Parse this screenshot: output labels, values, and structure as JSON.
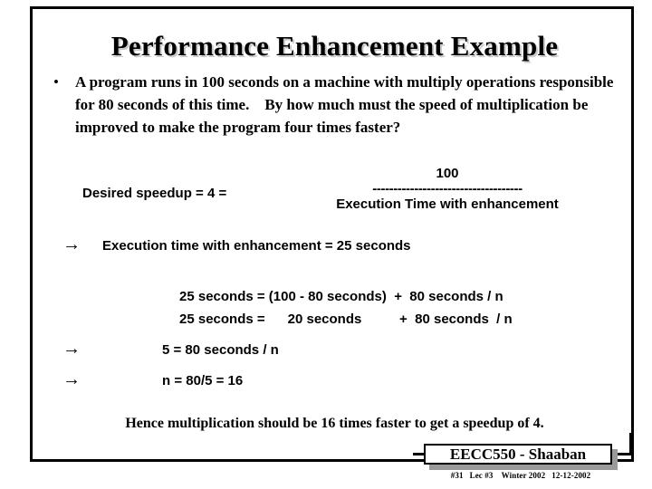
{
  "slide": {
    "title": "Performance Enhancement Example",
    "bullet": {
      "marker": "•",
      "text": "A program runs in 100 seconds on a machine with multiply operations responsible for 80 seconds of this time.    By how much must the speed of multiplication be improved to make the program four times faster?"
    },
    "equation": {
      "label": "Desired speedup =  4  =",
      "numerator": "100",
      "bar": "------------------------------------",
      "denominator": "Execution Time with enhancement"
    },
    "steps": [
      {
        "arrow": "→",
        "text": "Execution time with enhancement  =  25 seconds"
      },
      {
        "arrow": "→",
        "text": "5  =  80 seconds  / n"
      },
      {
        "arrow": "→",
        "text": "n  =   80/5 =  16"
      }
    ],
    "calculations": [
      "25 seconds = (100 - 80 seconds)  +  80 seconds / n",
      "25 seconds =      20 seconds          +  80 seconds  / n"
    ],
    "conclusion": "Hence multiplication should be 16 times faster to get a speedup of 4.",
    "footer": {
      "badge": "EECC550 - Shaaban",
      "meta": "#31   Lec #3    Winter 2002   12-12-2002"
    }
  }
}
